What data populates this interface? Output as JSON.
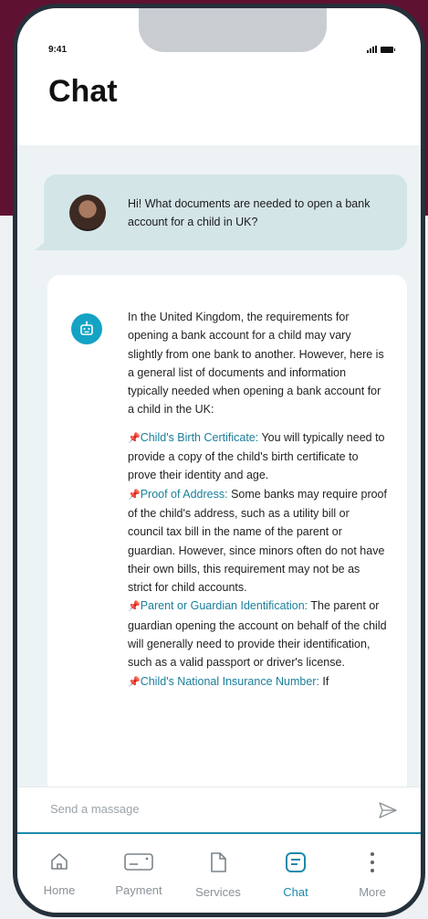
{
  "status": {
    "time": "9:41"
  },
  "header": {
    "title": "Chat"
  },
  "messages": {
    "user": "Hi! What documents are needed to open a bank account for a child in UK?",
    "bot_intro": "In the United Kingdom, the requirements for opening a bank account for a child may vary slightly from one bank to another. However, here is a general list of documents and information typically needed when opening a bank account for a child in the UK:",
    "items": [
      {
        "title": "Child's Birth Certificate:",
        "text": " You will typically need to provide a copy of the child's birth certificate to prove their identity and age."
      },
      {
        "title": "Proof of Address:",
        "text": " Some banks may require proof of the child's address, such as a utility bill or council tax bill in the name of the parent or guardian. However, since minors often do not have their own bills, this requirement may not be as strict for child accounts."
      },
      {
        "title": "Parent or Guardian Identification:",
        "text": " The parent or guardian opening the account on behalf of the child will generally need to provide their identification, such as a valid passport or driver's license."
      },
      {
        "title": "Child's National Insurance Number:",
        "text": " If"
      }
    ]
  },
  "input": {
    "placeholder": "Send a massage"
  },
  "tabs": [
    {
      "label": "Home",
      "icon": "home-icon"
    },
    {
      "label": "Payment",
      "icon": "card-icon"
    },
    {
      "label": "Services",
      "icon": "document-icon"
    },
    {
      "label": "Chat",
      "icon": "chat-icon"
    },
    {
      "label": "More",
      "icon": "more-icon"
    }
  ],
  "colors": {
    "accent": "#1b8aaa",
    "brand_bg": "#5f1131",
    "bot_icon": "#14a3c4"
  }
}
